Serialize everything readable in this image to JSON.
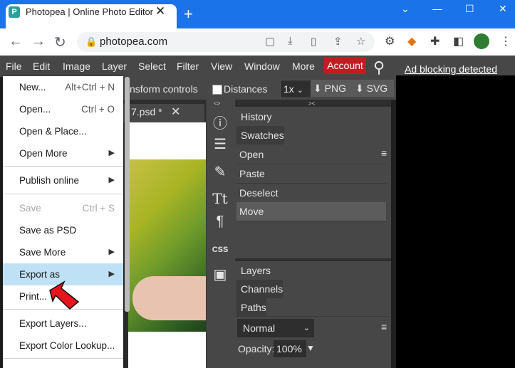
{
  "browser": {
    "tab_title": "Photopea | Online Photo Editor",
    "tab_close": "✕",
    "new_tab": "+",
    "url": "photopea.com",
    "window_controls": [
      "⌄",
      "—",
      "☐",
      "✕"
    ]
  },
  "app": {
    "menus": [
      "File",
      "Edit",
      "Image",
      "Layer",
      "Select",
      "Filter",
      "View",
      "Window",
      "More"
    ],
    "account_label": "Account",
    "ad_notice": "Ad blocking detected",
    "options": {
      "transform_label": "nsform controls",
      "distances_label": "Distances",
      "zoom": "1x",
      "png_label": "PNG",
      "svg_label": "SVG"
    },
    "doc_tab_title": "7.psd *",
    "doc_tab_close": "✕",
    "panels": {
      "top_tabs": [
        "History",
        "Swatches"
      ],
      "history": [
        "Open",
        "Paste",
        "Deselect",
        "Move"
      ],
      "layer_tabs": [
        "Layers",
        "Channels",
        "Paths"
      ],
      "blend_mode": "Normal",
      "opacity_label": "Opacity:",
      "opacity_value": "100%"
    }
  },
  "file_menu": {
    "items": [
      {
        "label": "New...",
        "shortcut": "Alt+Ctrl + N"
      },
      {
        "label": "Open...",
        "shortcut": "Ctrl + O"
      },
      {
        "label": "Open & Place...",
        "shortcut": ""
      },
      {
        "label": "Open More",
        "shortcut": "▶"
      },
      {
        "label": "Publish online",
        "shortcut": "▶"
      },
      {
        "label": "Save",
        "shortcut": "Ctrl + S"
      },
      {
        "label": "Save as PSD",
        "shortcut": ""
      },
      {
        "label": "Save More",
        "shortcut": "▶"
      },
      {
        "label": "Export as",
        "shortcut": "▶"
      },
      {
        "label": "Print...",
        "shortcut": ""
      },
      {
        "label": "Export Layers...",
        "shortcut": ""
      },
      {
        "label": "Export Color Lookup...",
        "shortcut": ""
      }
    ]
  },
  "colors": {
    "accent": "#1a73e8",
    "account_red": "#c41a24",
    "menu_highlight": "#bfe1f6",
    "arrow_red": "#e8141b"
  }
}
